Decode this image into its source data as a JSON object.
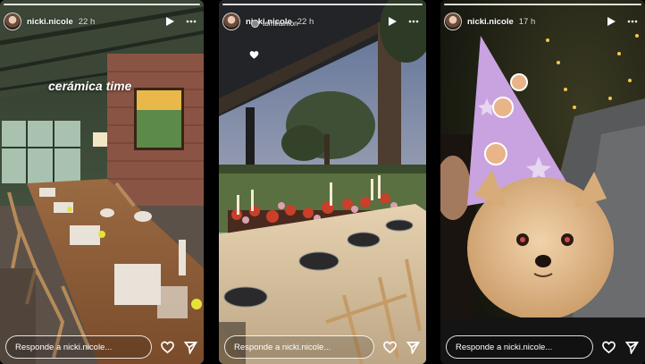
{
  "stories": [
    {
      "username": "nicki.nicole",
      "time": "22 h",
      "caption": "cerámica time",
      "reply_placeholder": "Responde a nicki.nicole..."
    },
    {
      "username": "nicki.nicole",
      "time": "22 h",
      "mention": "tomiraimon",
      "reply_placeholder": "Responde a nicki.nicole..."
    },
    {
      "username": "nicki.nicole",
      "time": "17 h",
      "reply_placeholder": "Responde a nicki.nicole..."
    }
  ],
  "icons": {
    "play": "play-icon",
    "more": "more-options-icon",
    "like": "heart-icon",
    "share": "send-icon"
  },
  "colors": {
    "progress": "#ffffff",
    "overlay_text": "#ffffff"
  }
}
